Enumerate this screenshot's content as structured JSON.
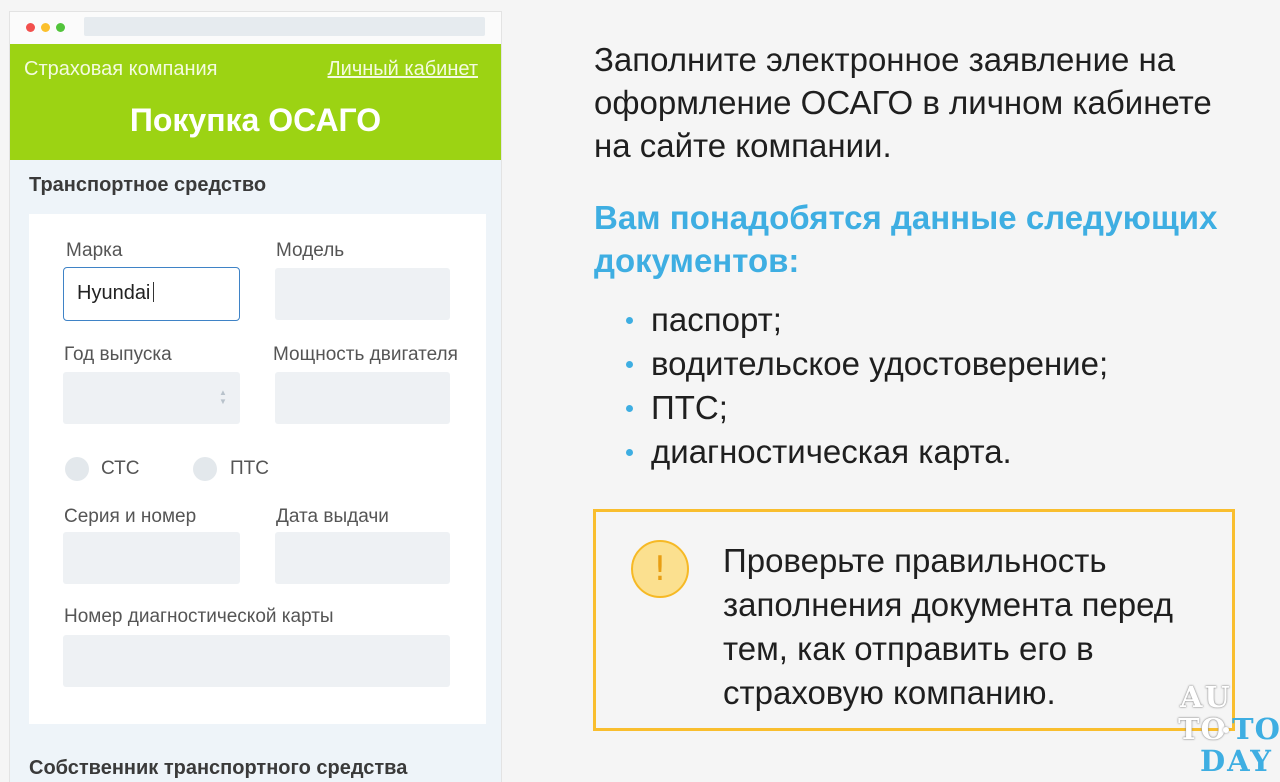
{
  "browser": {
    "header": {
      "company_label": "Страховая компания",
      "cabinet_link": "Личный кабинет",
      "title": "Покупка ОСАГО"
    },
    "vehicle_section": {
      "title": "Транспортное средство",
      "brand_label": "Марка",
      "brand_value": "Hyundai",
      "model_label": "Модель",
      "year_label": "Год выпуска",
      "power_label": "Мощность двигателя",
      "radio_sts": "СТС",
      "radio_pts": "ПТС",
      "series_label": "Серия и номер",
      "issue_date_label": "Дата выдачи",
      "diag_card_label": "Номер диагностической карты"
    },
    "owner_section": {
      "title": "Собственник транспортного средства"
    }
  },
  "info": {
    "intro": "Заполните электронное заявление на оформление ОСАГО в личном кабинете на сайте компании.",
    "docs_heading": "Вам понадобятся данные следующих документов:",
    "documents": [
      "паспорт;",
      "водительское удостоверение;",
      "ПТС;",
      "диагностическая карта."
    ],
    "warning_icon": "exclamation-icon",
    "warning_text": "Проверьте правильность заполнения документа перед тем, как отправить его в страховую компанию."
  },
  "watermark": {
    "line1": "AU",
    "line2a": "TO",
    "line2b": "TO",
    "line3": "DAY"
  },
  "colors": {
    "header_green": "#9cd313",
    "accent_blue": "#3eaee2",
    "warning_orange": "#f9be2e",
    "focus_border": "#3f83c6"
  }
}
